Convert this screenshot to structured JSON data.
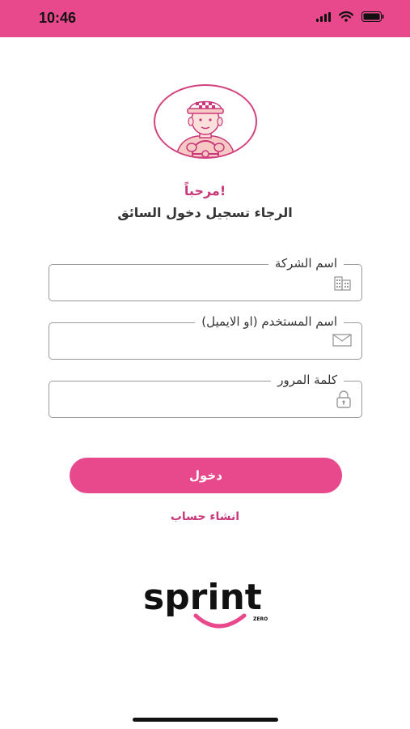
{
  "status_bar": {
    "time": "10:46",
    "icons": [
      "signal-icon",
      "wifi-icon",
      "battery-icon"
    ],
    "color": "#e8498c"
  },
  "header": {
    "avatar_icon": "taxi-driver-icon",
    "welcome": "مرحباً!",
    "subtitle": "الرجاء تسجيل دخول السائق"
  },
  "form": {
    "company": {
      "label": "اسم الشركة",
      "value": "",
      "icon": "building-icon"
    },
    "username": {
      "label": "اسم المستخدم (او الايميل)",
      "value": "",
      "icon": "envelope-icon"
    },
    "password": {
      "label": "كلمة المرور",
      "value": "",
      "icon": "lock-icon"
    }
  },
  "actions": {
    "login_label": "دخول",
    "create_account_label": "انشاء حساب"
  },
  "logo": {
    "word": "sprint",
    "tag": "ZERO",
    "accent": "#e8498c"
  },
  "colors": {
    "primary": "#e8498c",
    "accent_text": "#c9387a"
  }
}
